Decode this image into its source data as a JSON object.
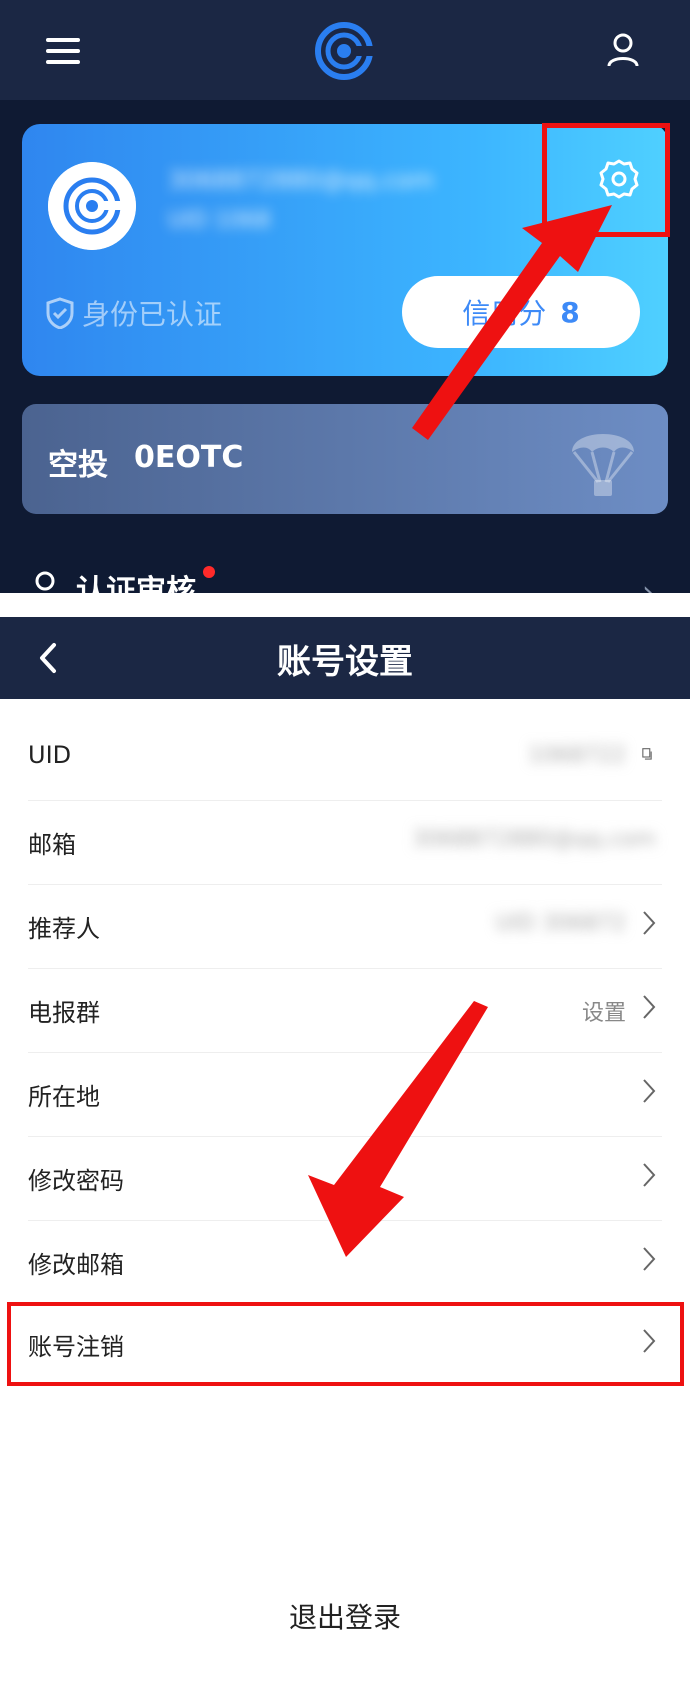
{
  "top_screen": {
    "email": "3068872880@qq.com",
    "uid": "UID 1068",
    "verified_label": "身份已认证",
    "credit_label": "信用分",
    "credit_score": "8",
    "airdrop_label": "空投",
    "airdrop_value": "0EOTC",
    "cert_label": "认证审核",
    "icons": [
      "menu-icon",
      "logo-icon",
      "user-icon",
      "gear-icon",
      "shield-icon",
      "parachute-icon",
      "person-icon"
    ]
  },
  "settings_screen": {
    "title": "账号设置",
    "rows": [
      {
        "label": "UID",
        "value": "1068722"
      },
      {
        "label": "邮箱",
        "value": "3068872880@qq.com"
      },
      {
        "label": "推荐人",
        "value": "UID 306872"
      },
      {
        "label": "电报群",
        "value": "设置"
      },
      {
        "label": "所在地",
        "value": ""
      },
      {
        "label": "修改密码",
        "value": ""
      },
      {
        "label": "修改邮箱",
        "value": ""
      },
      {
        "label": "账号注销",
        "value": ""
      }
    ],
    "logout_label": "退出登录"
  },
  "colors": {
    "dark_navy": "#1b2744",
    "accent_blue": "#3d8af7",
    "highlight_red": "#ee1111"
  }
}
